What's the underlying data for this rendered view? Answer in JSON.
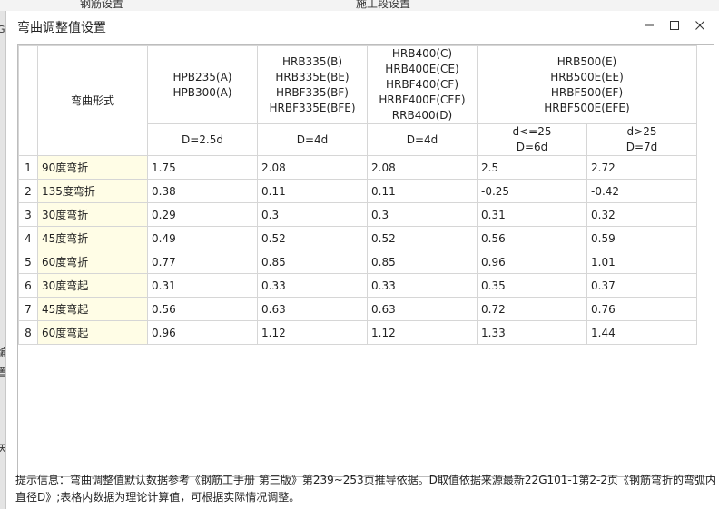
{
  "background": {
    "tab_left": "钢筋设置",
    "tab_right": "施工段设置",
    "side_chars": [
      "G",
      "编",
      "置",
      "天"
    ]
  },
  "dialog": {
    "title": "弯曲调整值设置",
    "minimize_label": "—",
    "maximize_label": "□",
    "close_label": "✕"
  },
  "table": {
    "bend_header": "弯曲形式",
    "groups": [
      {
        "grades": [
          "HPB235(A)",
          "HPB300(A)"
        ],
        "diameters": [
          "D=2.5d"
        ]
      },
      {
        "grades": [
          "HRB335(B)",
          "HRB335E(BE)",
          "HRBF335(BF)",
          "HRBF335E(BFE)"
        ],
        "diameters": [
          "D=4d"
        ]
      },
      {
        "grades": [
          "HRB400(C)",
          "HRB400E(CE)",
          "HRBF400(CF)",
          "HRBF400E(CFE)",
          "RRB400(D)"
        ],
        "diameters": [
          "D=4d"
        ]
      },
      {
        "grades": [
          "HRB500(E)",
          "HRB500E(EE)",
          "HRBF500(EF)",
          "HRBF500E(EFE)"
        ],
        "diameters": [
          "d<=25\nD=6d",
          "d>25\nD=7d"
        ]
      }
    ],
    "rows": [
      {
        "index": "1",
        "bend": "90度弯折",
        "values": [
          "1.75",
          "2.08",
          "2.08",
          "2.5",
          "2.72"
        ]
      },
      {
        "index": "2",
        "bend": "135度弯折",
        "values": [
          "0.38",
          "0.11",
          "0.11",
          "-0.25",
          "-0.42"
        ]
      },
      {
        "index": "3",
        "bend": "30度弯折",
        "values": [
          "0.29",
          "0.3",
          "0.3",
          "0.31",
          "0.32"
        ]
      },
      {
        "index": "4",
        "bend": "45度弯折",
        "values": [
          "0.49",
          "0.52",
          "0.52",
          "0.56",
          "0.59"
        ]
      },
      {
        "index": "5",
        "bend": "60度弯折",
        "values": [
          "0.77",
          "0.85",
          "0.85",
          "0.96",
          "1.01"
        ]
      },
      {
        "index": "6",
        "bend": "30度弯起",
        "values": [
          "0.31",
          "0.33",
          "0.33",
          "0.35",
          "0.37"
        ]
      },
      {
        "index": "7",
        "bend": "45度弯起",
        "values": [
          "0.56",
          "0.63",
          "0.63",
          "0.72",
          "0.76"
        ]
      },
      {
        "index": "8",
        "bend": "60度弯起",
        "values": [
          "0.96",
          "1.12",
          "1.12",
          "1.33",
          "1.44"
        ]
      }
    ]
  },
  "info_text": "提示信息：弯曲调整值默认数据参考《钢筋工手册  第三版》第239~253页推导依据。D取值依据来源最新22G101-1第2-2页《钢筋弯折的弯弧内直径D》;表格内数据为理论计算值，可根据实际情况调整。"
}
